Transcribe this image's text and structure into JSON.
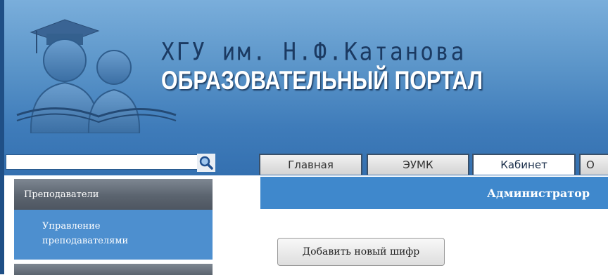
{
  "header": {
    "title_line1": "ХГУ им. Н.Ф.Катанова",
    "title_line2": "ОБРАЗОВАТЕЛЬНЫЙ ПОРТАЛ"
  },
  "search": {
    "value": "",
    "icon": "search-icon"
  },
  "nav": {
    "tabs": [
      {
        "label": "Главная",
        "active": false
      },
      {
        "label": "ЭУМК",
        "active": false
      },
      {
        "label": "Кабинет",
        "active": true
      },
      {
        "label": "О",
        "active": false
      }
    ]
  },
  "sidebar": {
    "section_title": "Преподаватели",
    "items": [
      {
        "label_line1": "Управление",
        "label_line2": "преподавателями"
      }
    ]
  },
  "main": {
    "section_title": "Администратор",
    "add_button_label": "Добавить новый шифр"
  },
  "colors": {
    "header_blue": "#3f7cba",
    "sidebar_active": "#4d8fcf",
    "sidebar_header": "#5b646f",
    "content_bar": "#3f88cc"
  }
}
